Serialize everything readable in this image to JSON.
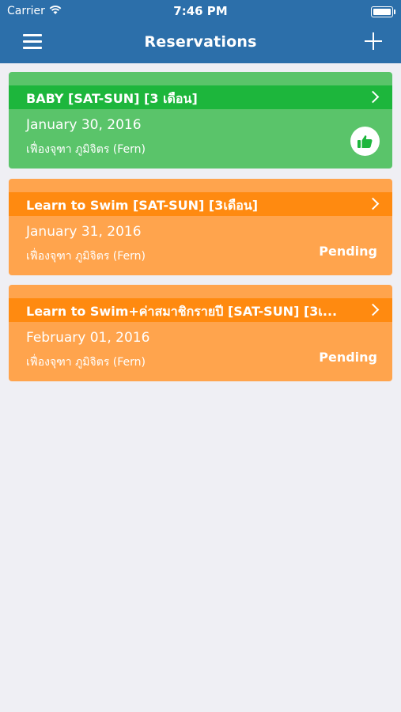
{
  "status_bar": {
    "carrier": "Carrier",
    "time": "7:46 PM"
  },
  "navbar": {
    "title": "Reservations"
  },
  "reservations": [
    {
      "title": "BABY [SAT-SUN] [3 เดือน]",
      "date": "January 30, 2016",
      "person": "เฟื่องจุฑา ภูมิจิตร (Fern)",
      "status": ""
    },
    {
      "title": "Learn to Swim [SAT-SUN] [3เดือน]",
      "date": "January 31, 2016",
      "person": "เฟื่องจุฑา ภูมิจิตร (Fern)",
      "status": "Pending"
    },
    {
      "title": "Learn to Swim+ค่าสมาชิกรายปี [SAT-SUN] [3เ...",
      "date": "February 01, 2016",
      "person": "เฟื่องจุฑา ภูมิจิตร (Fern)",
      "status": "Pending"
    }
  ],
  "colors": {
    "navbar": "#2c6faa",
    "approved_header": "#1db63c",
    "approved_body": "#5ac46a",
    "pending_header": "#ff8a10",
    "pending_body": "#ffa44d",
    "background": "#efeff4"
  },
  "icons": {
    "menu": "hamburger-icon",
    "add": "plus-icon",
    "chevron": "chevron-right-icon",
    "approved": "thumbs-up-icon"
  }
}
